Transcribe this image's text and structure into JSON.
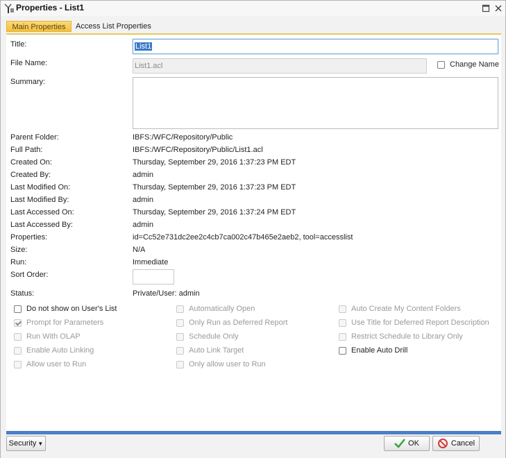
{
  "window": {
    "title": "Properties - List1"
  },
  "tabs": [
    {
      "label": "Main Properties",
      "active": true
    },
    {
      "label": "Access List Properties",
      "active": false
    }
  ],
  "form": {
    "title_label": "Title:",
    "title_value": "List1",
    "file_name_label": "File Name:",
    "file_name_value": "List1.acl",
    "change_name_label": "Change Name",
    "summary_label": "Summary:",
    "summary_value": ""
  },
  "info": [
    {
      "label": "Parent Folder:",
      "value": "IBFS:/WFC/Repository/Public"
    },
    {
      "label": "Full Path:",
      "value": "IBFS:/WFC/Repository/Public/List1.acl"
    },
    {
      "label": "Created On:",
      "value": "Thursday, September 29, 2016 1:37:23 PM EDT"
    },
    {
      "label": "Created By:",
      "value": "admin"
    },
    {
      "label": "Last Modified On:",
      "value": "Thursday, September 29, 2016 1:37:23 PM EDT"
    },
    {
      "label": "Last Modified By:",
      "value": "admin"
    },
    {
      "label": "Last Accessed On:",
      "value": "Thursday, September 29, 2016 1:37:24 PM EDT"
    },
    {
      "label": "Last Accessed By:",
      "value": "admin"
    },
    {
      "label": "Properties:",
      "value": "id=Cc52e731dc2ee2c4cb7ca002c47b465e2aeb2, tool=accesslist"
    },
    {
      "label": "Size:",
      "value": "N/A"
    },
    {
      "label": "Run:",
      "value": "Immediate"
    }
  ],
  "sort_order": {
    "label": "Sort Order:",
    "value": ""
  },
  "status": {
    "label": "Status:",
    "value": "Private/User: admin"
  },
  "checkboxes": [
    {
      "label": "Do not show on User's List",
      "checked": false,
      "enabled": true
    },
    {
      "label": "Automatically Open",
      "checked": false,
      "enabled": false
    },
    {
      "label": "Auto Create My Content Folders",
      "checked": false,
      "enabled": false
    },
    {
      "label": "Prompt for Parameters",
      "checked": true,
      "enabled": false
    },
    {
      "label": "Only Run as Deferred Report",
      "checked": false,
      "enabled": false
    },
    {
      "label": "Use Title for Deferred Report Description",
      "checked": false,
      "enabled": false
    },
    {
      "label": "Run With OLAP",
      "checked": false,
      "enabled": false
    },
    {
      "label": "Schedule Only",
      "checked": false,
      "enabled": false
    },
    {
      "label": "Restrict Schedule to Library Only",
      "checked": false,
      "enabled": false
    },
    {
      "label": "Enable Auto Linking",
      "checked": false,
      "enabled": false
    },
    {
      "label": "Auto Link Target",
      "checked": false,
      "enabled": false
    },
    {
      "label": "Enable Auto Drill",
      "checked": false,
      "enabled": true
    },
    {
      "label": "Allow user to Run",
      "checked": false,
      "enabled": false
    },
    {
      "label": "Only allow user to Run",
      "checked": false,
      "enabled": false
    }
  ],
  "footer": {
    "security_label": "Security",
    "ok_label": "OK",
    "cancel_label": "Cancel"
  },
  "colors": {
    "tab_active": "#f3bf3d",
    "accent_bar": "#4a7fc9",
    "ok_check": "#3aa33a",
    "cancel_icon": "#d23a3a"
  }
}
